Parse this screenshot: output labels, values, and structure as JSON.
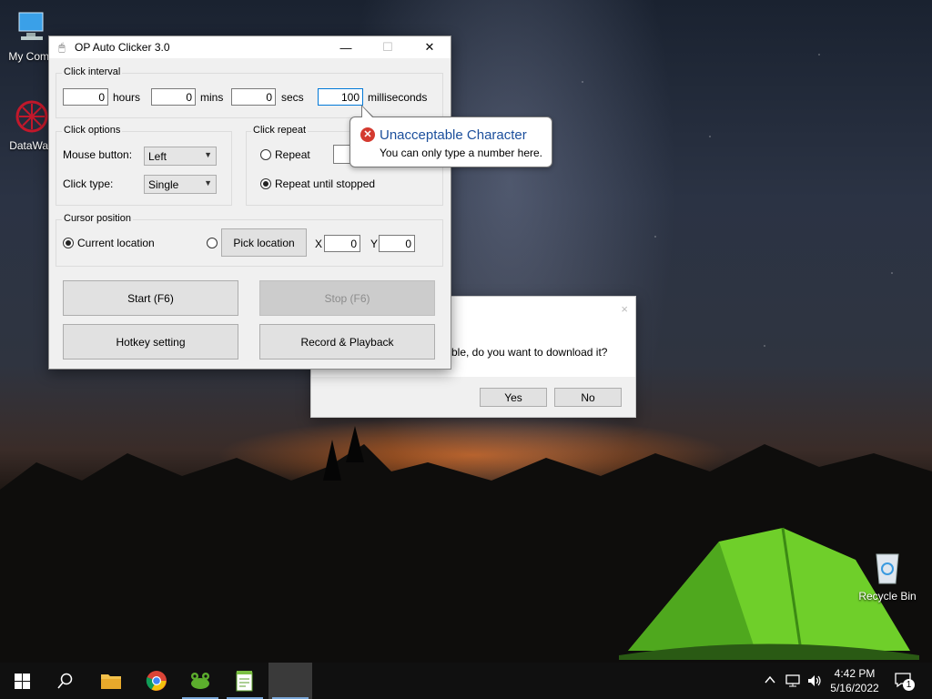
{
  "desktop": {
    "icons": [
      {
        "label": "My Comp",
        "icon": "computer-icon"
      },
      {
        "label": "DataWag",
        "icon": "datawagon-icon"
      },
      {
        "label": "Recycle Bin",
        "icon": "recycle-bin-icon"
      }
    ]
  },
  "dialog": {
    "message": "ble, do you want to download it?",
    "yes_label": "Yes",
    "no_label": "No",
    "close_glyph": "×"
  },
  "window": {
    "title": "OP Auto Clicker 3.0",
    "controls": {
      "minimize": "—",
      "maximize": "☐",
      "close": "✕"
    },
    "click_interval": {
      "label": "Click interval",
      "hours": {
        "value": "0",
        "unit": "hours"
      },
      "mins": {
        "value": "0",
        "unit": "mins"
      },
      "secs": {
        "value": "0",
        "unit": "secs"
      },
      "milliseconds": {
        "value": "100",
        "unit": "milliseconds"
      }
    },
    "click_options": {
      "label": "Click options",
      "mouse_button_label": "Mouse button:",
      "mouse_button_value": "Left",
      "click_type_label": "Click type:",
      "click_type_value": "Single"
    },
    "click_repeat": {
      "label": "Click repeat",
      "repeat_label": "Repeat",
      "repeat_until_stopped_label": "Repeat until stopped",
      "selected": "Repeat until stopped"
    },
    "cursor_position": {
      "label": "Cursor position",
      "current_location_label": "Current location",
      "pick_location_label": "Pick location",
      "x_label": "X",
      "x_value": "0",
      "y_label": "Y",
      "y_value": "0",
      "selected": "Current location"
    },
    "buttons": {
      "start": "Start (F6)",
      "stop": "Stop (F6)",
      "hotkey": "Hotkey setting",
      "record": "Record & Playback"
    }
  },
  "tooltip": {
    "title": "Unacceptable Character",
    "message": "You can only type a number here.",
    "icon": "error-icon"
  },
  "taskbar": {
    "items": [
      "start-icon",
      "search-icon",
      "file-explorer-icon",
      "chrome-icon",
      "app-frog-icon",
      "app-notepad-icon",
      "active-window"
    ],
    "time": "4:42 PM",
    "date": "5/16/2022",
    "notification_count": "1"
  }
}
